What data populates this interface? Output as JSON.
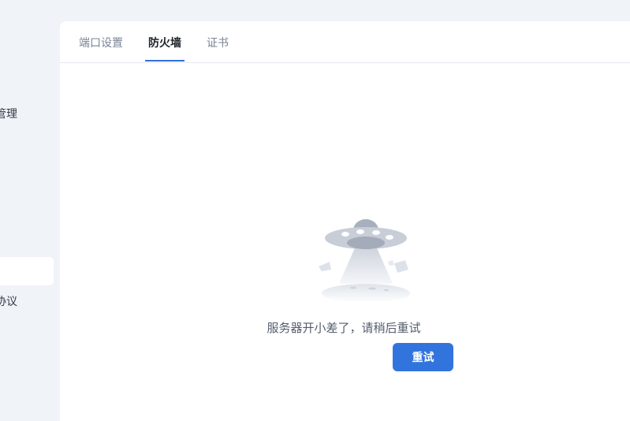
{
  "sidebar": {
    "items": [
      {
        "label": "管理"
      },
      {
        "label": "协议"
      }
    ]
  },
  "tabs": [
    {
      "label": "端口设置",
      "active": false
    },
    {
      "label": "防火墙",
      "active": true
    },
    {
      "label": "证书",
      "active": false
    }
  ],
  "empty_state": {
    "icon": "ufo-illustration",
    "message": "服务器开小差了，请稍后重试",
    "retry_label": "重试"
  },
  "colors": {
    "accent": "#3274de",
    "background": "#f0f3f8"
  }
}
